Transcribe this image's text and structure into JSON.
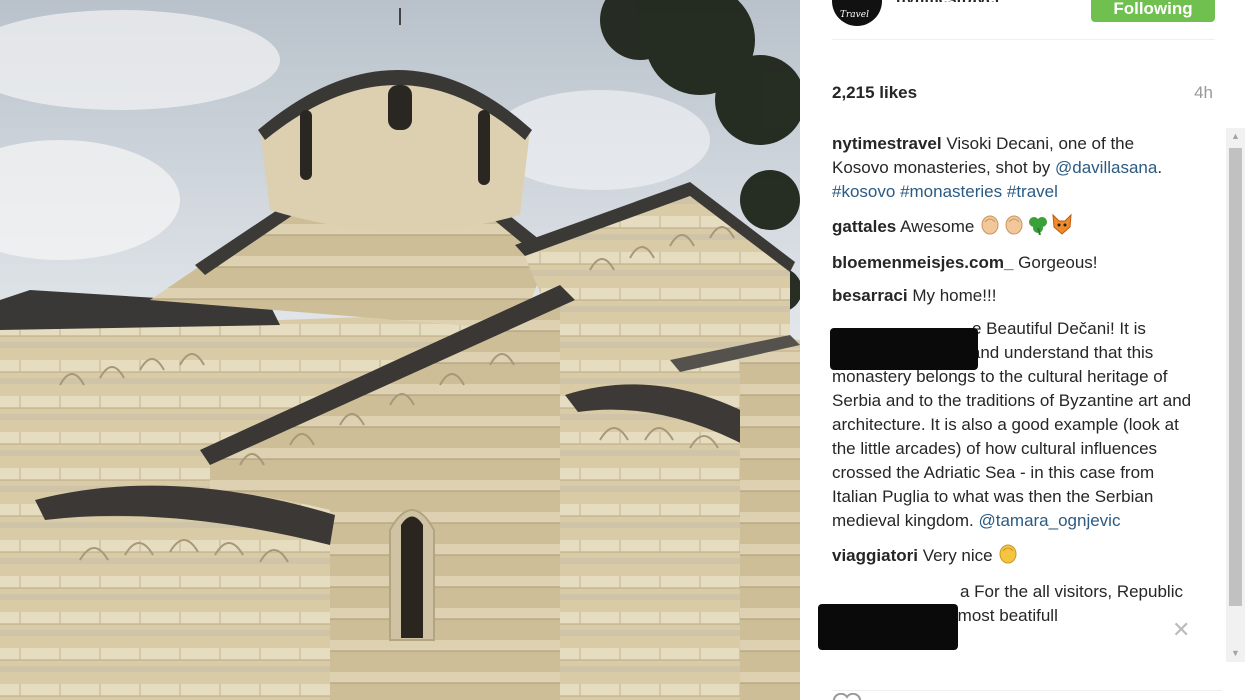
{
  "account": {
    "username": "nytimestravel",
    "avatar_text": "Travel",
    "follow_label": "Following"
  },
  "post": {
    "likes": "2,215 likes",
    "time": "4h"
  },
  "caption": {
    "user": "nytimestravel",
    "text": " Visoki Decani, one of the Kosovo monasteries, shot by ",
    "mention": "@davillasana",
    "sep": ". ",
    "tags": [
      "#kosovo",
      "#monasteries",
      "#travel"
    ]
  },
  "comments": [
    {
      "user": "gattales",
      "text": " Awesome "
    },
    {
      "user": "bloemenmeisjes.com_",
      "text": " Gorgeous!"
    },
    {
      "user": "besarraci",
      "text": " My home!!!"
    },
    {
      "user": "",
      "text": "e Beautiful Dečani! It is important to know and understand that this monastery belongs to the cultural heritage of Serbia and to the traditions of Byzantine art and architecture. It is also a good example (look at the little arcades) of how cultural influences crossed the Adriatic Sea - in this case from Italian Puglia to what was then the Serbian medieval kingdom. ",
      "mention": "@tamara_ognjevic"
    },
    {
      "user": "viaggiatori",
      "text": " Very nice "
    },
    {
      "user": "",
      "text": "a For the all visitors, Republic of Kosova is the most beatifull"
    }
  ],
  "icons": {
    "clap": "clapping-hands-icon",
    "clover": "shamrock-icon",
    "fox": "fox-face-icon",
    "close": "close-icon",
    "heart": "heart-icon"
  },
  "colors": {
    "follow_green": "#70c050",
    "link_blue": "#2b5a83"
  }
}
